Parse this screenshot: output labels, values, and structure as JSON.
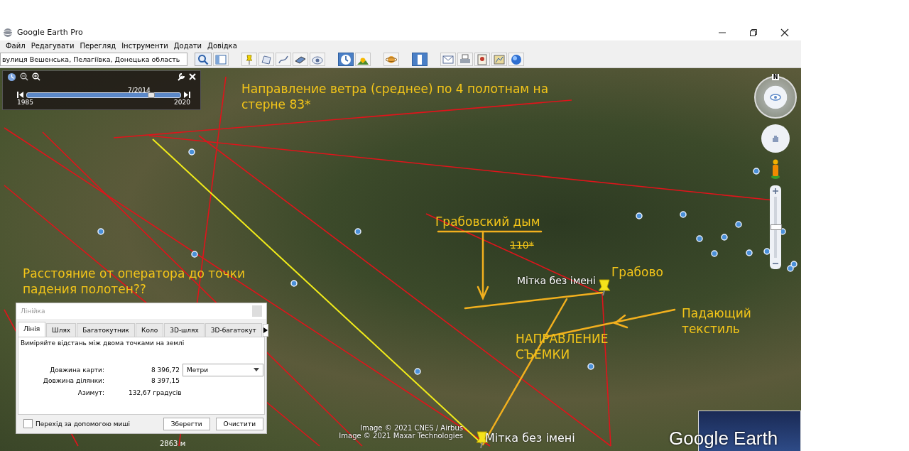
{
  "window": {
    "title": "Google Earth Pro"
  },
  "menu": [
    "Файл",
    "Редагувати",
    "Перегляд",
    "Інструменти",
    "Додати",
    "Довідка"
  ],
  "search": {
    "value": "вулиця Вешенська, Пелагіївка, Донецька область"
  },
  "toolbar": [
    {
      "kind": "sidebar",
      "pressed": false
    },
    {
      "kind": "placemark",
      "pressed": false
    },
    {
      "kind": "polygon",
      "pressed": false
    },
    {
      "kind": "path",
      "pressed": false
    },
    {
      "kind": "overlay",
      "pressed": false
    },
    {
      "kind": "tour",
      "pressed": false
    },
    {
      "kind": "history",
      "pressed": true
    },
    {
      "kind": "sun",
      "pressed": false
    },
    {
      "kind": "planet",
      "pressed": false
    },
    {
      "kind": "ruler",
      "pressed": true
    },
    {
      "kind": "email",
      "pressed": false
    },
    {
      "kind": "print",
      "pressed": false
    },
    {
      "kind": "image",
      "pressed": false
    },
    {
      "kind": "map",
      "pressed": false
    },
    {
      "kind": "globe",
      "pressed": false
    }
  ],
  "time_slider": {
    "date": "7/2014",
    "start": "1985",
    "end": "2020",
    "level": 0.81
  },
  "annotations": [
    {
      "text": "Направление ветра (среднее) по 4 полотнам на стерне 83*",
      "struck": false
    },
    {
      "text": "Грабовский дым",
      "struck": false
    },
    {
      "text": "110*",
      "struck": true
    },
    {
      "text": "Расстояние от оператора до точки падения полотен??",
      "struck": false
    },
    {
      "text": "Грабово",
      "struck": false
    },
    {
      "text": "Падающий текстиль",
      "struck": false
    },
    {
      "text": "НАПРАВЛЕНИЕ СЪЕМКИ",
      "struck": false
    }
  ],
  "placemarks": [
    {
      "label": "Мітка без імені"
    },
    {
      "label": "Мітка без імені"
    }
  ],
  "attribution": [
    "Image © 2021 CNES / Airbus",
    "Image © 2021 Maxar Technologies"
  ],
  "scale": "2863 м",
  "logo": "Google Earth",
  "navigation": {
    "compass_label": "N",
    "zoom_slider": {
      "level": 0.5
    }
  },
  "ruler_dialog": {
    "title": "Лінійка",
    "tabs": [
      {
        "label": "Лінія",
        "selected": true
      },
      {
        "label": "Шлях",
        "selected": false
      },
      {
        "label": "Багатокутник",
        "selected": false
      },
      {
        "label": "Коло",
        "selected": false
      },
      {
        "label": "3D-шлях",
        "selected": false
      },
      {
        "label": "3D-багатокут",
        "selected": false
      }
    ],
    "description": "Виміряйте відстань між двома точками на землі",
    "rows": [
      {
        "label": "Довжина карти:",
        "value": "8 396,72"
      },
      {
        "label": "Довжина ділянки:",
        "value": "8 397,15"
      },
      {
        "label": "Азимут:",
        "value": "132,67 градусів"
      }
    ],
    "unit": "Метри",
    "mouse_nav": {
      "label": "Перехід за допомогою миші",
      "checked": false
    },
    "buttons": [
      "Зберегти",
      "Очистити"
    ]
  }
}
